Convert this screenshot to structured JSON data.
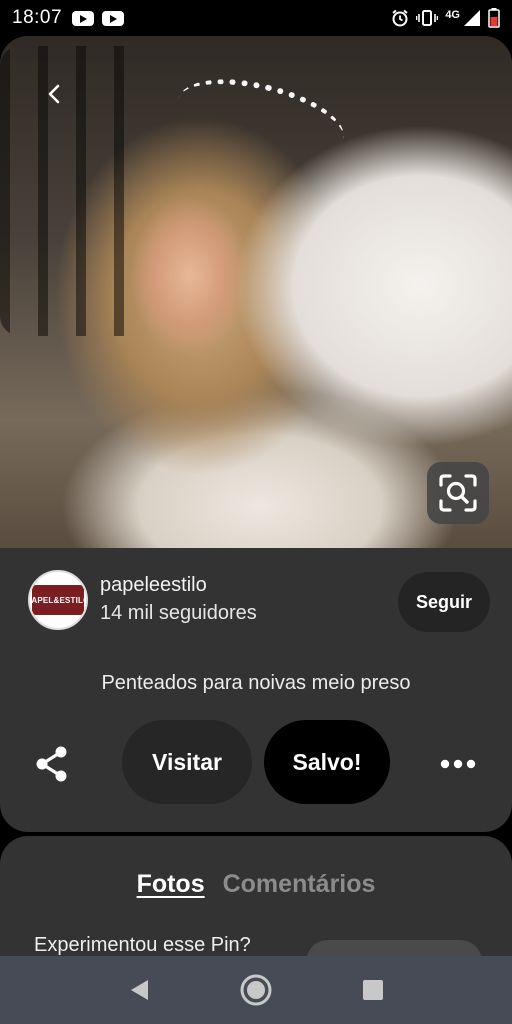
{
  "status_bar": {
    "time": "18:07",
    "network": "4G",
    "icons": [
      "youtube-icon",
      "youtube-icon",
      "alarm-icon",
      "vibrate-icon",
      "signal-icon",
      "battery-icon"
    ]
  },
  "hero": {
    "back_icon": "chevron-left-icon",
    "lens_icon": "visual-search-icon"
  },
  "account": {
    "name": "papeleestilo",
    "followers": "14 mil seguidores",
    "avatar_text": "PAPEL&ESTILO",
    "follow_label": "Seguir"
  },
  "pin": {
    "title": "Penteados para noivas meio preso"
  },
  "actions": {
    "share_icon": "share-icon",
    "visit_label": "Visitar",
    "saved_label": "Salvo!",
    "more_icon": "more-icon"
  },
  "lower": {
    "tabs": [
      {
        "label": "Fotos",
        "active": true
      },
      {
        "label": "Comentários",
        "active": false
      }
    ],
    "tried_prompt": "Experimentou esse Pin?"
  },
  "nav": {
    "icons": [
      "back-icon",
      "home-icon",
      "recents-icon"
    ]
  },
  "colors": {
    "panel": "#333333",
    "button_dark": "#262626",
    "saved_button": "#000000",
    "nav_bar": "#464b55"
  }
}
